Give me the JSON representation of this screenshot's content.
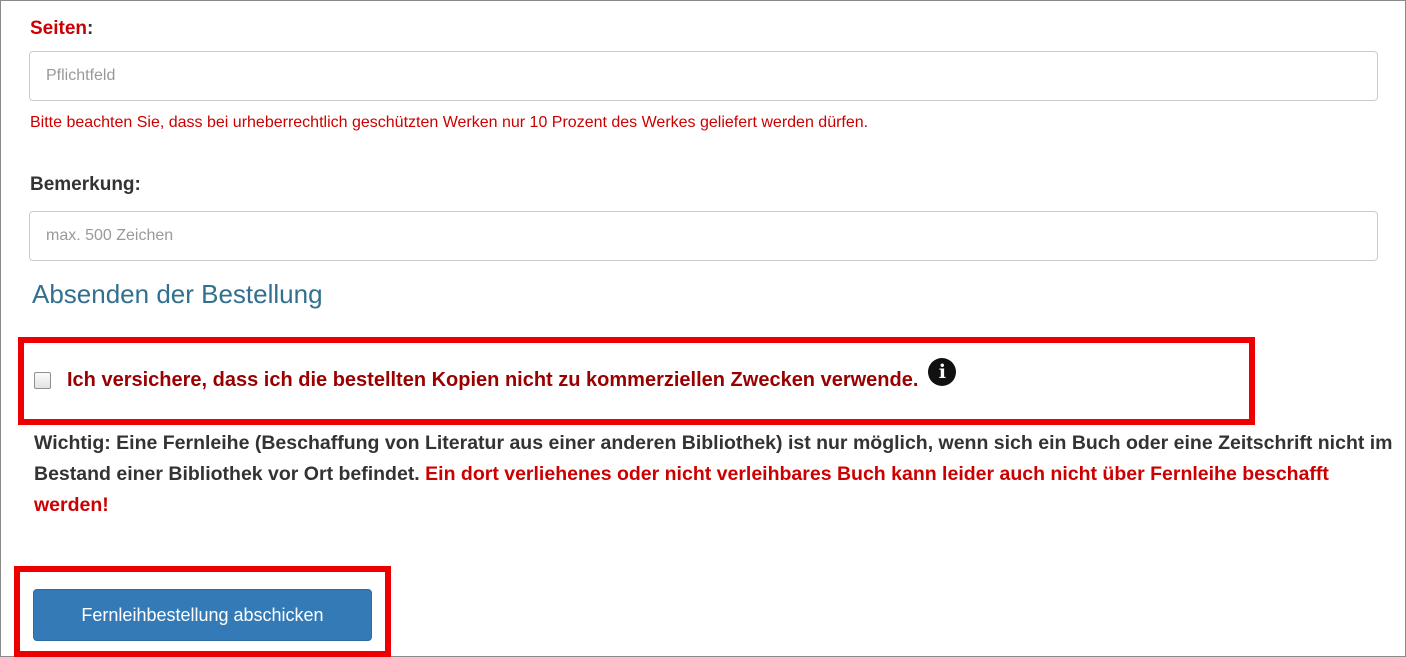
{
  "form": {
    "seiten_label": "Seiten",
    "seiten_colon": ":",
    "seiten_placeholder": "Pflichtfeld",
    "copyright_note": "Bitte beachten Sie, dass bei urheberrechtlich geschützten Werken nur 10 Prozent des Werkes geliefert werden dürfen.",
    "bemerkung_label": "Bemerkung:",
    "bemerkung_placeholder": "max. 500 Zeichen"
  },
  "submission": {
    "heading": "Absenden der Bestellung",
    "consent_text": "Ich versichere, dass ich die bestellten Kopien nicht zu kommerziellen Zwecken verwende.",
    "consent_checked": false,
    "info_icon": "info-circle-icon",
    "info_glyph": "i",
    "important_text": "Wichtig: Eine Fernleihe (Beschaffung von Literatur aus einer anderen Bibliothek) ist nur möglich, wenn sich ein Buch oder eine Zeitschrift nicht im Bestand einer Bibliothek vor Ort befindet.",
    "important_warning": "Ein dort verliehenes oder nicht verleihbares Buch kann leider auch nicht über Fernleihe beschafft werden!",
    "submit_label": "Fernleihbestellung abschicken"
  },
  "colors": {
    "required_red": "#cc0000",
    "consent_red": "#9a0000",
    "highlight_box": "#ee0000",
    "heading_blue": "#31708f",
    "button_blue": "#337ab7"
  }
}
